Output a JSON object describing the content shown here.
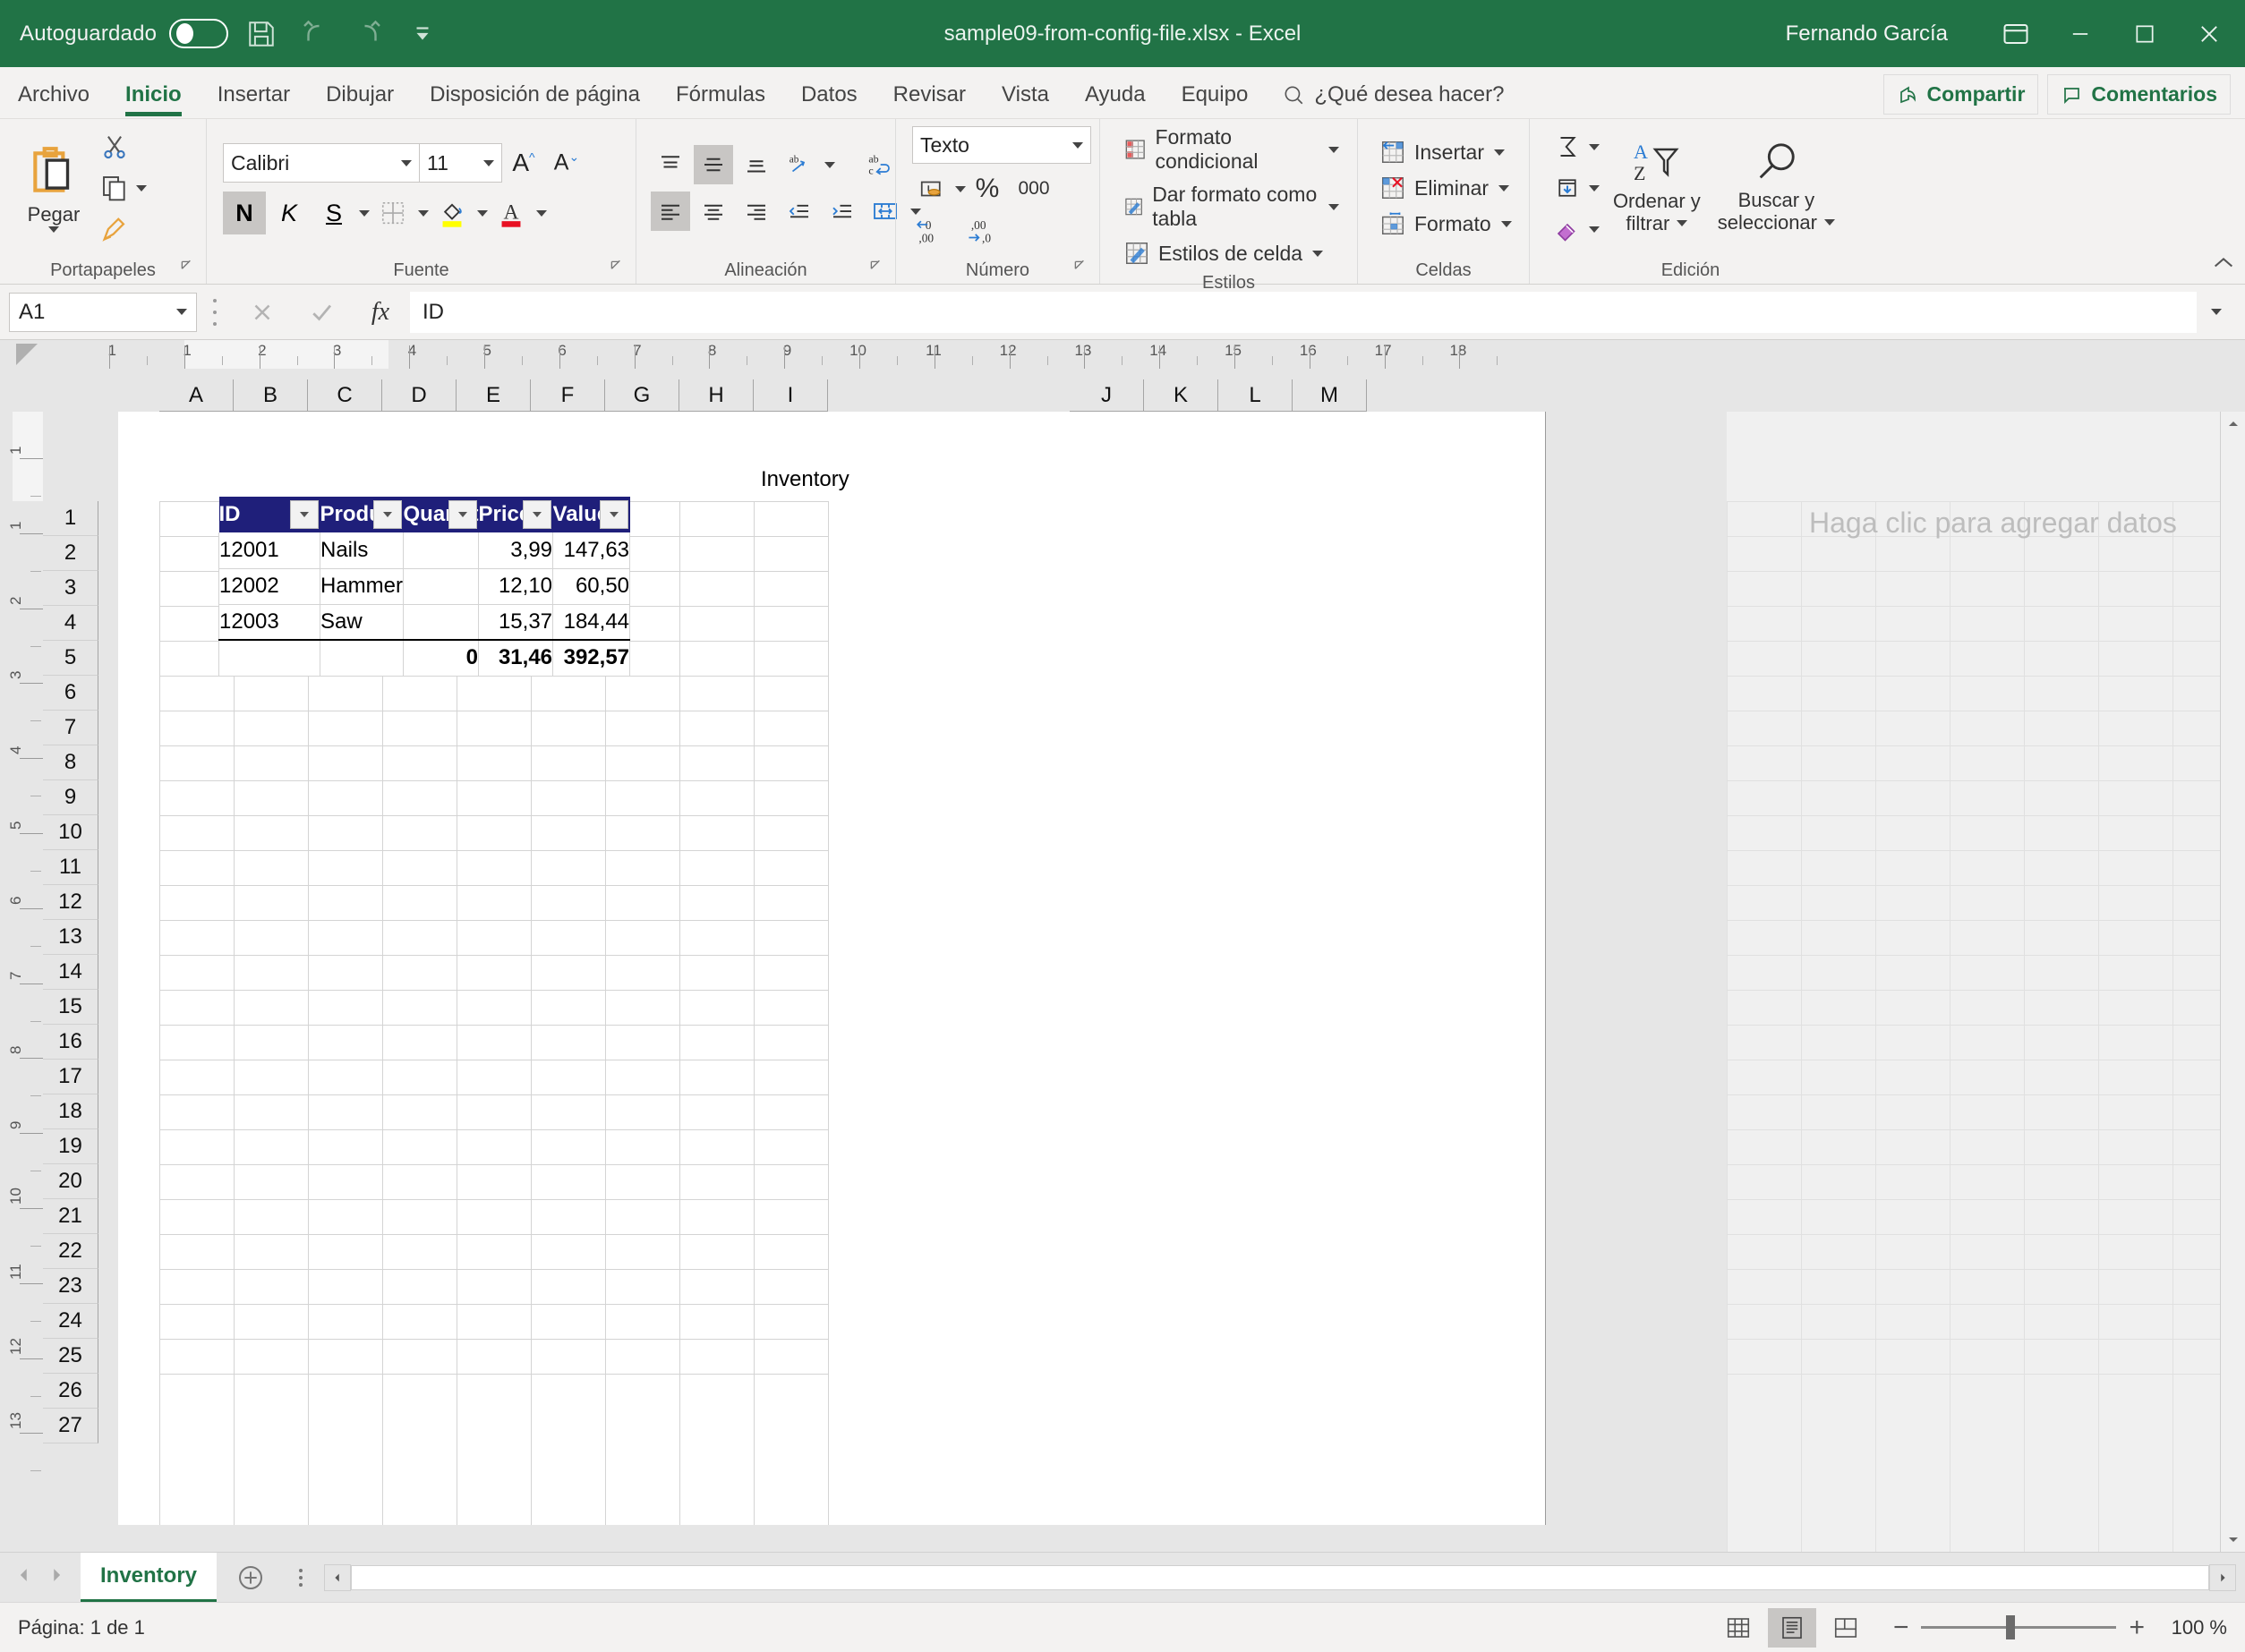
{
  "titlebar": {
    "autosave_label": "Autoguardado",
    "autosave_state": "off",
    "save_icon": "save-icon",
    "undo_icon": "undo-icon",
    "redo_icon": "redo-icon",
    "qat_more_icon": "qat-customize-icon",
    "document_title": "sample09-from-config-file.xlsx  -  Excel",
    "user_name": "Fernando García",
    "ribbon_display_icon": "ribbon-display-options-icon",
    "minimize_icon": "minimize-icon",
    "maximize_icon": "maximize-icon",
    "close_icon": "close-icon"
  },
  "tabs": {
    "items": [
      {
        "label": "Archivo",
        "active": false
      },
      {
        "label": "Inicio",
        "active": true
      },
      {
        "label": "Insertar",
        "active": false
      },
      {
        "label": "Dibujar",
        "active": false
      },
      {
        "label": "Disposición de página",
        "active": false
      },
      {
        "label": "Fórmulas",
        "active": false
      },
      {
        "label": "Datos",
        "active": false
      },
      {
        "label": "Revisar",
        "active": false
      },
      {
        "label": "Vista",
        "active": false
      },
      {
        "label": "Ayuda",
        "active": false
      },
      {
        "label": "Equipo",
        "active": false
      }
    ],
    "tellme": "¿Qué desea hacer?",
    "share": "Compartir",
    "comments": "Comentarios"
  },
  "ribbon": {
    "clipboard": {
      "label": "Portapapeles",
      "paste": "Pegar",
      "cut_icon": "scissors-icon",
      "copy_icon": "copy-icon",
      "format_painter_icon": "format-painter-icon"
    },
    "font": {
      "label": "Fuente",
      "family": "Calibri",
      "size": "11",
      "grow_icon": "increase-font-size-icon",
      "shrink_icon": "decrease-font-size-icon",
      "bold": "N",
      "italic": "K",
      "underline": "S",
      "borders_icon": "borders-icon",
      "fill_icon": "fill-color-icon",
      "fontcolor_icon": "font-color-icon",
      "bold_active": true
    },
    "alignment": {
      "label": "Alineación",
      "top_icon": "align-top-icon",
      "middle_icon": "align-middle-icon",
      "bottom_icon": "align-bottom-icon",
      "orientation_icon": "text-orientation-icon",
      "wrap_icon": "wrap-text-icon",
      "left_icon": "align-left-icon",
      "center_icon": "align-center-icon",
      "right_icon": "align-right-icon",
      "decrease_indent_icon": "decrease-indent-icon",
      "increase_indent_icon": "increase-indent-icon",
      "merge_icon": "merge-center-icon"
    },
    "number": {
      "label": "Número",
      "format": "Texto",
      "accounting_icon": "accounting-format-icon",
      "percent_icon": "percent-style-icon",
      "comma_icon": "comma-style-icon",
      "comma_label": "000",
      "increase_decimal_icon": "increase-decimal-icon",
      "decrease_decimal_icon": "decrease-decimal-icon"
    },
    "styles": {
      "label": "Estilos",
      "conditional": "Formato condicional",
      "as_table": "Dar formato como tabla",
      "cell_styles": "Estilos de celda"
    },
    "cells": {
      "label": "Celdas",
      "insert": "Insertar",
      "delete": "Eliminar",
      "format": "Formato"
    },
    "editing": {
      "label": "Edición",
      "autosum_icon": "autosum-icon",
      "fill_icon": "fill-down-icon",
      "clear_icon": "clear-eraser-icon",
      "sort_filter": "Ordenar y\nfiltrar",
      "sort_filter_l1": "Ordenar y",
      "sort_filter_l2": "filtrar",
      "find_select_l1": "Buscar y",
      "find_select_l2": "seleccionar"
    },
    "collapse_icon": "collapse-ribbon-icon"
  },
  "formula_bar": {
    "name_box": "A1",
    "cancel_icon": "cancel-icon",
    "enter_icon": "confirm-check-icon",
    "function_icon": "insert-function-icon",
    "formula_value": "ID",
    "expand_icon": "expand-formula-bar-icon"
  },
  "sheet": {
    "columns": [
      "A",
      "B",
      "C",
      "D",
      "E",
      "F",
      "G",
      "H",
      "I",
      "J",
      "K",
      "L",
      "M"
    ],
    "rows": [
      1,
      2,
      3,
      4,
      5,
      6,
      7,
      8,
      9,
      10,
      11,
      12,
      13,
      14,
      15,
      16,
      17,
      18,
      19,
      20,
      21,
      22,
      23,
      24,
      25,
      26,
      27
    ],
    "h_ruler_ticks": [
      1,
      1,
      2,
      3,
      4,
      5,
      6,
      7,
      8,
      9,
      10,
      11,
      12,
      13,
      14,
      15,
      16,
      17,
      18
    ],
    "v_ruler_ticks": [
      1,
      1,
      2,
      3,
      4,
      5,
      6,
      7,
      8,
      9,
      10,
      11,
      12,
      13
    ],
    "chart_title": "Inventory",
    "placeholder_message": "Haga clic para agregar datos",
    "table": {
      "headers": [
        "ID",
        "Product",
        "Quantit",
        "Price",
        "Value"
      ],
      "rows": [
        {
          "id": "12001",
          "product": "Nails",
          "quantity": "",
          "price": "3,99",
          "value": "147,63"
        },
        {
          "id": "12002",
          "product": "Hammer",
          "quantity": "",
          "price": "12,10",
          "value": "60,50"
        },
        {
          "id": "12003",
          "product": "Saw",
          "quantity": "",
          "price": "15,37",
          "value": "184,44"
        }
      ],
      "total": {
        "id": "",
        "product": "",
        "quantity": "0",
        "price": "31,46",
        "value": "392,57"
      },
      "header_bg": "#1f1f7a",
      "filter_icon": "filter-dropdown-icon"
    }
  },
  "sheet_tabs": {
    "prev_icon": "previous-sheet-icon",
    "next_icon": "next-sheet-icon",
    "items": [
      {
        "label": "Inventory",
        "active": true
      }
    ],
    "add_icon": "add-sheet-icon",
    "scroll_left_icon": "scroll-left-icon",
    "scroll_right_icon": "scroll-right-icon"
  },
  "statusbar": {
    "page_status": "Página: 1 de 1",
    "view_normal_icon": "normal-view-icon",
    "view_pagelayout_icon": "page-layout-view-icon",
    "view_pagebreak_icon": "page-break-preview-icon",
    "zoom_out": "−",
    "zoom_in": "+",
    "zoom_value": "100 %"
  },
  "colors": {
    "excel_green": "#217346",
    "table_header": "#1f1f7a",
    "ribbon_bg": "#f3f2f1"
  }
}
